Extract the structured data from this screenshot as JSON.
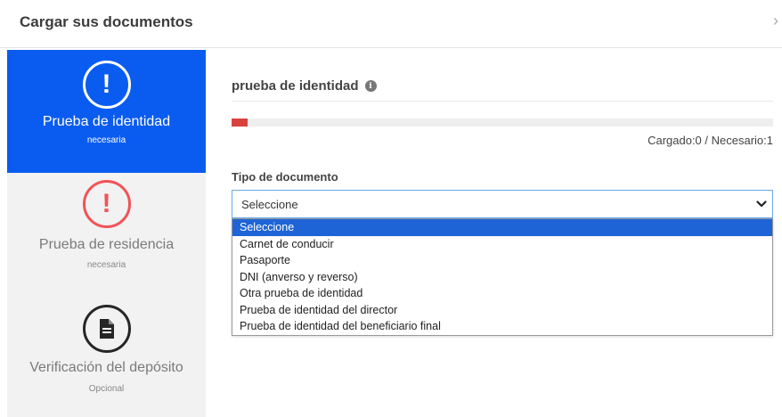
{
  "header": {
    "title": "Cargar sus documentos",
    "close_label": "›"
  },
  "sidebar": {
    "steps": [
      {
        "label": "Prueba de identidad",
        "status": "necesaria",
        "icon": "exclamation-icon",
        "glyph": "!",
        "state": "active"
      },
      {
        "label": "Prueba de residencia",
        "status": "necesaria",
        "icon": "exclamation-icon",
        "glyph": "!",
        "state": "missing"
      },
      {
        "label": "Verificación del depósito",
        "status": "Opcional",
        "icon": "document-icon",
        "glyph": "",
        "state": "optional"
      }
    ]
  },
  "main": {
    "section_title": "prueba de identidad",
    "info_glyph": "i",
    "progress": {
      "fraction": 0.03,
      "text": "Cargado:0 / Necesario:1"
    },
    "field_label": "Tipo de documento",
    "select": {
      "value": "Seleccione",
      "options": [
        "Seleccione",
        "Carnet de conducir",
        "Pasaporte",
        "DNI (anverso y reverso)",
        "Otra prueba de identidad",
        "Prueba de identidad del director",
        "Prueba de identidad del beneficiario final"
      ],
      "highlighted_index": 0
    }
  },
  "colors": {
    "active_step_bg": "#0a5cf0",
    "missing_icon": "#f05358",
    "optional_icon": "#262626",
    "progress_fill": "#d9423f",
    "option_highlight": "#1e64d6",
    "select_border": "#6aa9e8"
  }
}
